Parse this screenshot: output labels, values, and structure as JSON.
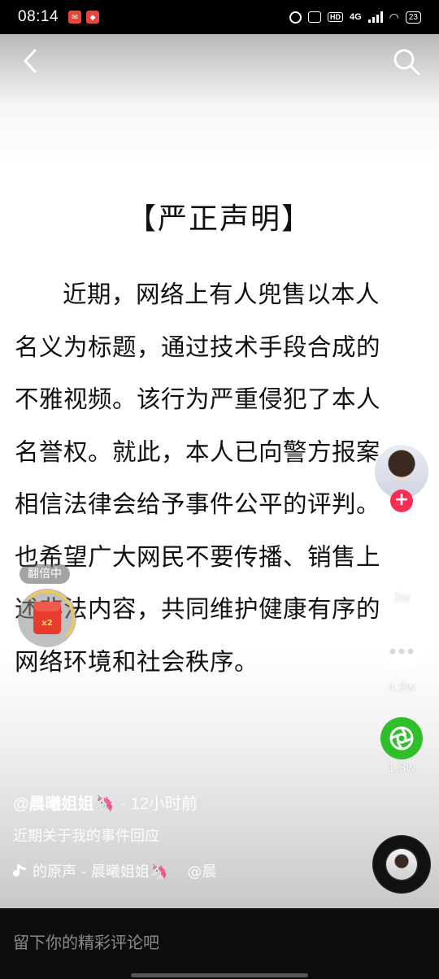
{
  "status_bar": {
    "time": "08:14",
    "network": "4G",
    "hd": "HD",
    "battery": "23"
  },
  "document": {
    "title": "【严正声明】",
    "body": "近期，网络上有人兜售以本人名义为标题，通过技术手段合成的不雅视频。该行为严重侵犯了本人名誉权。就此，本人已向警方报案相信法律会给予事件公平的评判。也希望广大网民不要传播、销售上述非法内容，共同维护健康有序的网络环境和社会秩序。"
  },
  "actions": {
    "follow": "+",
    "likes": "3w",
    "comments": "4.9w",
    "shares": "1.3w"
  },
  "redpack": {
    "tag": "翻倍中",
    "multiplier": "x2"
  },
  "post": {
    "author": "@晨曦姐姐🦄",
    "time": "· 12小时前",
    "description": "近期关于我的事件回应",
    "music": "的原声 - 晨曦姐姐🦄",
    "music_suffix": "@晨"
  },
  "comment_bar": {
    "placeholder": "留下你的精彩评论吧"
  },
  "colors": {
    "follow_red": "#fe2c55",
    "share_green": "#2fbf2a"
  }
}
